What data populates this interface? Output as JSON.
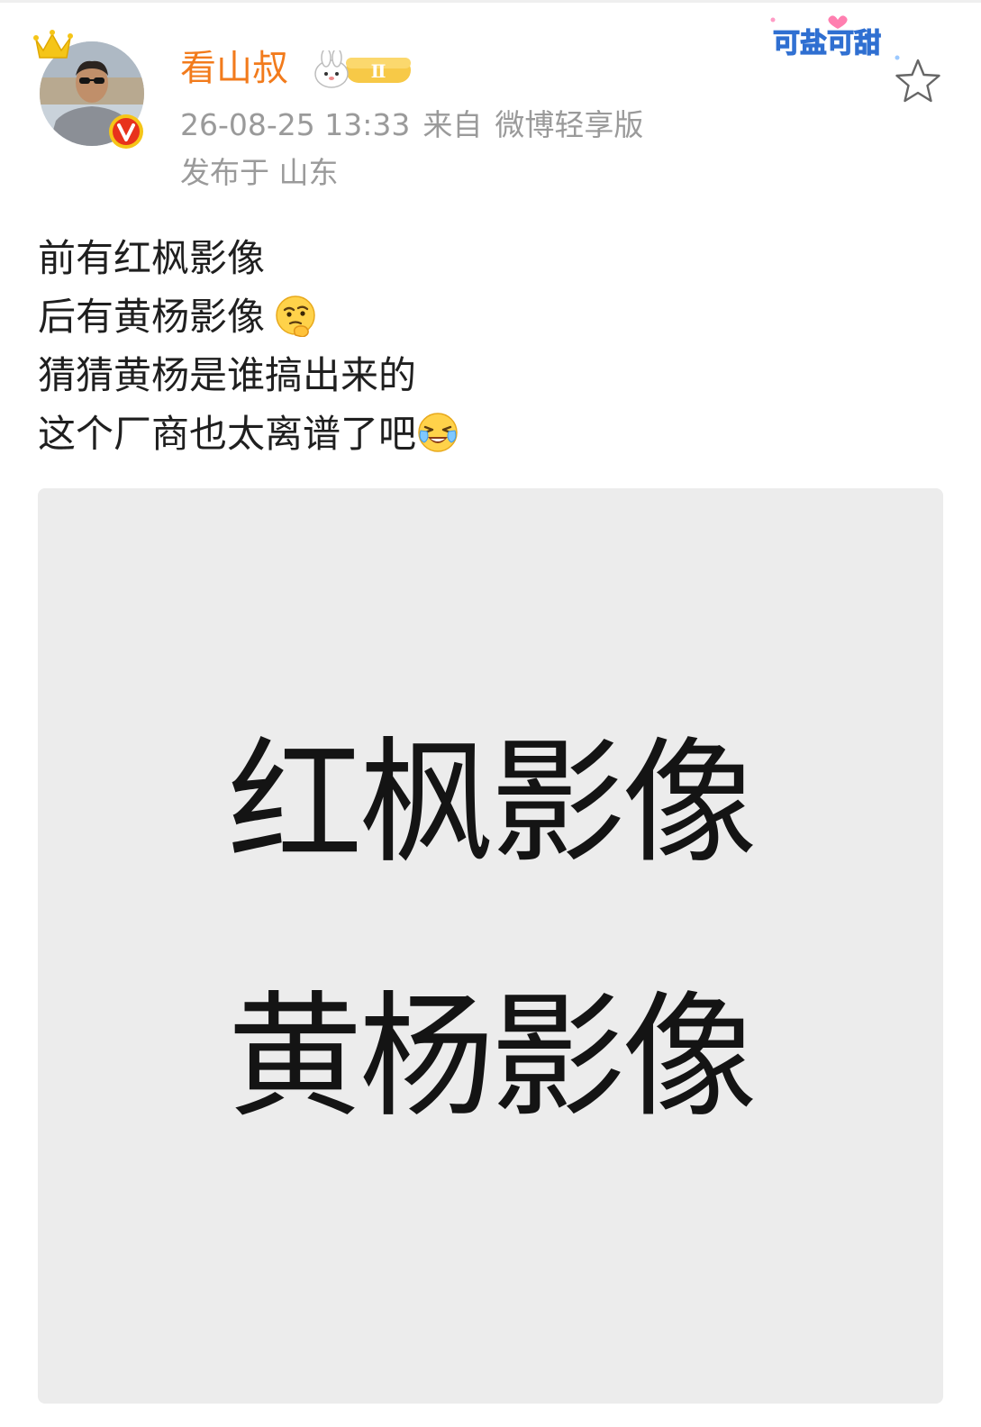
{
  "user": {
    "name": "看山叔",
    "badge_level": "Ⅱ",
    "avatar_icon": "avatar-photo",
    "verified_icon": "verified-badge-icon",
    "crown_icon": "crown-icon"
  },
  "meta": {
    "time": "26-08-25 13:33",
    "source_prefix": "来自",
    "source": "微博轻享版",
    "location": "发布于 山东"
  },
  "sticker": {
    "text": "可盐可甜"
  },
  "post": {
    "lines": [
      "前有红枫影像",
      "后有黄杨影像",
      "猜猜黄杨是谁搞出来的",
      "这个厂商也太离谱了吧"
    ],
    "emoji_line2": "thinking-emoji",
    "emoji_line4": "laughing-crying-emoji"
  },
  "image": {
    "text_line1": "红枫影像",
    "text_line2": "黄杨影像",
    "background": "#ececec"
  },
  "colors": {
    "username": "#f27b1c",
    "meta": "#9a9a9a",
    "verified": "#e8321c"
  }
}
